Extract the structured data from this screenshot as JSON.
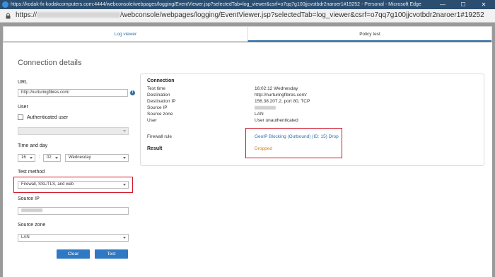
{
  "window": {
    "title": "https://kodak-fx-kodakcomputers.com:4444/webconsole/webpages/logging/EventViewer.jsp?selectedTab=log_viewer&csrf=o7qq7g100jjcvotbdr2naroer1#19252 - Personal - Microsoft Edge",
    "minimize": "—",
    "maximize": "☐",
    "close": "✕"
  },
  "address": {
    "prefix": "https://",
    "suffix": "/webconsole/webpages/logging/EventViewer.jsp?selectedTab=log_viewer&csrf=o7qq7g100jjcvotbdr2naroer1#19252"
  },
  "tabs": [
    {
      "label": "Log viewer"
    },
    {
      "label": "Policy test"
    }
  ],
  "form": {
    "heading": "Connection details",
    "url_label": "URL",
    "url_value": "http://nurturingfibres.com/",
    "user_label": "User",
    "auth_label": "Authenticated user",
    "timeday_label": "Time and day",
    "hour": "16",
    "minute": "02",
    "day": "Wednesday",
    "method_label": "Test method",
    "method_value": "Firewall, SSL/TLS, and web",
    "source_ip_label": "Source IP",
    "source_zone_label": "Source zone",
    "source_zone_value": "LAN",
    "clear_label": "Clear",
    "test_label": "Test"
  },
  "result": {
    "connection_heading": "Connection",
    "rows": [
      {
        "label": "Test time",
        "value": "16:02:12 Wednesday"
      },
      {
        "label": "Destination",
        "value": "http://nurturingfibres.com/"
      },
      {
        "label": "Destination IP",
        "value": "156.38.207.2, port 80, TCP"
      },
      {
        "label": "Source IP",
        "value": ""
      },
      {
        "label": "Source zone",
        "value": "LAN"
      },
      {
        "label": "User",
        "value": "User unauthenticated"
      }
    ],
    "firewall_label": "Firewall rule",
    "firewall_value": "GeoIP Blocking (Outbound) (ID: 15) Drop",
    "result_label": "Result",
    "result_value": "Dropped"
  },
  "colors": {
    "accent": "#2f6fa8",
    "button": "#2f78c4",
    "highlight_box": "#d0192b",
    "dropped": "#d97d1a"
  }
}
